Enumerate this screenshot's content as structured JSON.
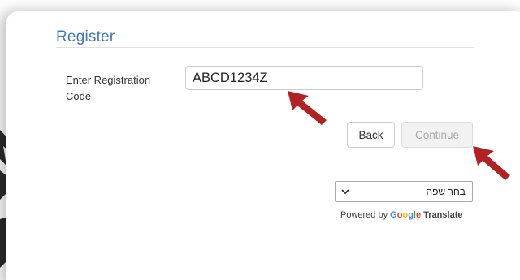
{
  "register": {
    "title": "Register",
    "label": "Enter Registration Code",
    "code_value": "ABCD1234Z"
  },
  "buttons": {
    "back_label": "Back",
    "continue_label": "Continue",
    "continue_enabled": false
  },
  "translate": {
    "selected_language": "בחר שפה",
    "powered_prefix": "Powered by",
    "google_letters": [
      {
        "ch": "G",
        "color": "#4285F4"
      },
      {
        "ch": "o",
        "color": "#EA4335"
      },
      {
        "ch": "o",
        "color": "#FBBC05"
      },
      {
        "ch": "g",
        "color": "#4285F4"
      },
      {
        "ch": "l",
        "color": "#34A853"
      },
      {
        "ch": "e",
        "color": "#EA4335"
      }
    ],
    "translate_word": "Translate"
  },
  "annotations": {
    "arrow_color": "#b22222"
  },
  "icons": {
    "dropdown": "chevron-down-icon",
    "pointer": "red-arrow-icon",
    "decor": "pencil-icon"
  }
}
